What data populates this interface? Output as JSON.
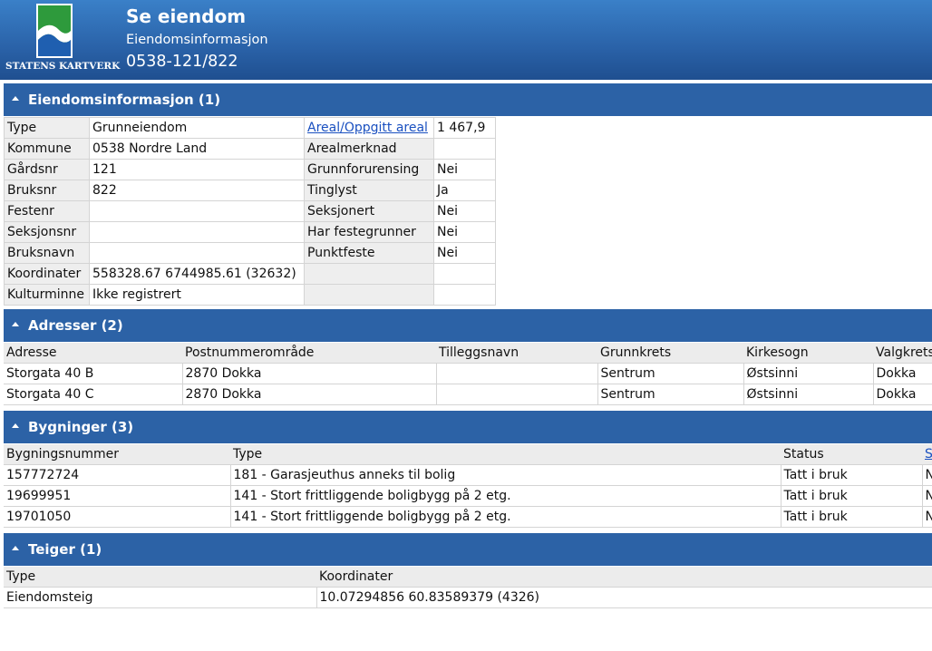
{
  "header": {
    "title": "Se eiendom",
    "subtitle": "Eiendomsinformasjon",
    "id": "0538-121/822",
    "logo_text": "STATENS KARTVERK",
    "bg_color": "#2a62a8"
  },
  "sections": {
    "info": {
      "title": "Eiendomsinformasjon (1)"
    },
    "adresser": {
      "title": "Adresser (2)"
    },
    "bygninger": {
      "title": "Bygninger (3)"
    },
    "teiger": {
      "title": "Teiger (1)"
    }
  },
  "info": {
    "type_label": "Type",
    "type_value": "Grunneiendom",
    "kommune_label": "Kommune",
    "kommune_value": "0538 Nordre Land",
    "gardsnr_label": "Gårdsnr",
    "gardsnr_value": "121",
    "bruksnr_label": "Bruksnr",
    "bruksnr_value": "822",
    "festenr_label": "Festenr",
    "festenr_value": "",
    "seksjonsnr_label": "Seksjonsnr",
    "seksjonsnr_value": "",
    "bruksnavn_label": "Bruksnavn",
    "bruksnavn_value": "",
    "koordinater_label": "Koordinater",
    "koordinater_value": "558328.67 6744985.61 (32632)",
    "kulturminne_label": "Kulturminne",
    "kulturminne_value": "Ikke registrert",
    "areal_label": "Areal/Oppgitt areal",
    "areal_value": "1 467,9",
    "arealmerknad_label": "Arealmerknad",
    "arealmerknad_value": "",
    "grunnforurensing_label": "Grunnforurensing",
    "grunnforurensing_value": "Nei",
    "tinglyst_label": "Tinglyst",
    "tinglyst_value": "Ja",
    "seksjonert_label": "Seksjonert",
    "seksjonert_value": "Nei",
    "festegrunner_label": "Har festegrunner",
    "festegrunner_value": "Nei",
    "punktfeste_label": "Punktfeste",
    "punktfeste_value": "Nei"
  },
  "adresser": {
    "columns": [
      "Adresse",
      "Postnummerområde",
      "Tilleggsnavn",
      "Grunnkrets",
      "Kirkesogn",
      "Valgkrets"
    ],
    "rows": [
      [
        "Storgata 40 B",
        "2870 Dokka",
        "",
        "Sentrum",
        "Østsinni",
        "Dokka"
      ],
      [
        "Storgata 40 C",
        "2870 Dokka",
        "",
        "Sentrum",
        "Østsinni",
        "Dokka"
      ]
    ]
  },
  "bygninger": {
    "columns": [
      "Bygningsnummer",
      "Type",
      "Status",
      "S"
    ],
    "rows": [
      [
        "157772724",
        "181 - Garasjeuthus anneks til bolig",
        "Tatt i bruk",
        "N"
      ],
      [
        "19699951",
        "141 - Stort frittliggende boligbygg på 2 etg.",
        "Tatt i bruk",
        "N"
      ],
      [
        "19701050",
        "141 - Stort frittliggende boligbygg på 2 etg.",
        "Tatt i bruk",
        "N"
      ]
    ]
  },
  "teiger": {
    "columns": [
      "Type",
      "Koordinater"
    ],
    "rows": [
      [
        "Eiendomsteig",
        "10.07294856 60.83589379 (4326)"
      ]
    ]
  }
}
